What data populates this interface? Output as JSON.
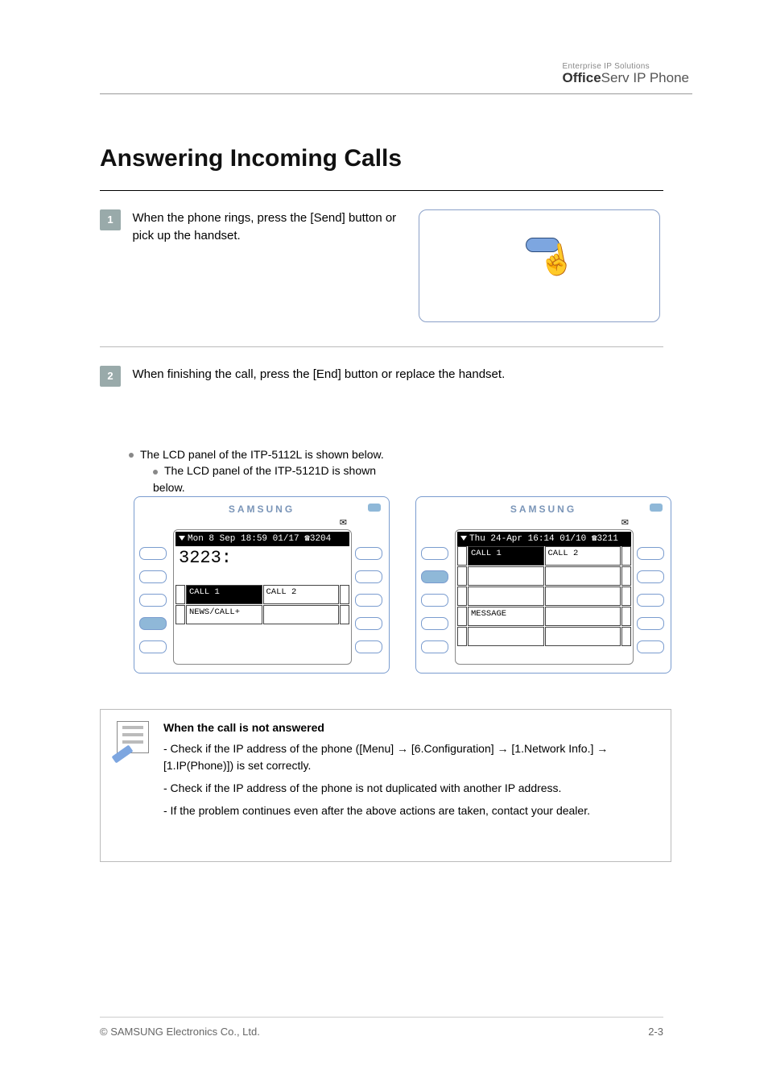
{
  "header": {
    "logo_small": "Enterprise IP Solutions",
    "logo_main_bold": "Office",
    "logo_main_thin": "Serv",
    "logo_main_tail": " IP Phone"
  },
  "section_title": "Answering Incoming Calls",
  "step1": {
    "num": "1",
    "text": "When the phone rings, press the [Send] button or pick up the handset."
  },
  "step2": {
    "num": "2",
    "text": "When finishing the call, press the [End] button or replace the handset.",
    "left_note": "The LCD panel of the ITP-5112L is shown below.",
    "right_note": "The LCD panel of the ITP-5121D is shown below."
  },
  "phones": {
    "brand": "SAMSUNG",
    "left": {
      "status": "Mon  8 Sep 18:59 01/17 ☎3204",
      "bigline": "3223:",
      "row1": [
        "CALL 1",
        "CALL 2"
      ],
      "row2": [
        "NEWS/CALL+",
        ""
      ]
    },
    "right": {
      "status": "Thu 24-Apr 16:14 01/10 ☎3211",
      "row1": [
        "CALL 1",
        "CALL 2"
      ],
      "row2": [
        "",
        ""
      ],
      "row3": [
        "",
        ""
      ],
      "row4": [
        "MESSAGE",
        ""
      ],
      "row5": [
        "",
        ""
      ]
    }
  },
  "note": {
    "title": "When the call is not answered",
    "p1": "- Check if the IP address of the phone ([Menu] → [6.Configuration] → [1.Network Info.] → [1.IP(Phone)]) is set correctly.",
    "p2": "- Check if the IP address of the phone is not duplicated with another IP address.",
    "p3": "- If the problem continues even after the above actions are taken, contact your dealer."
  },
  "footer": {
    "left": "© SAMSUNG Electronics Co., Ltd.",
    "right": "2-3"
  }
}
